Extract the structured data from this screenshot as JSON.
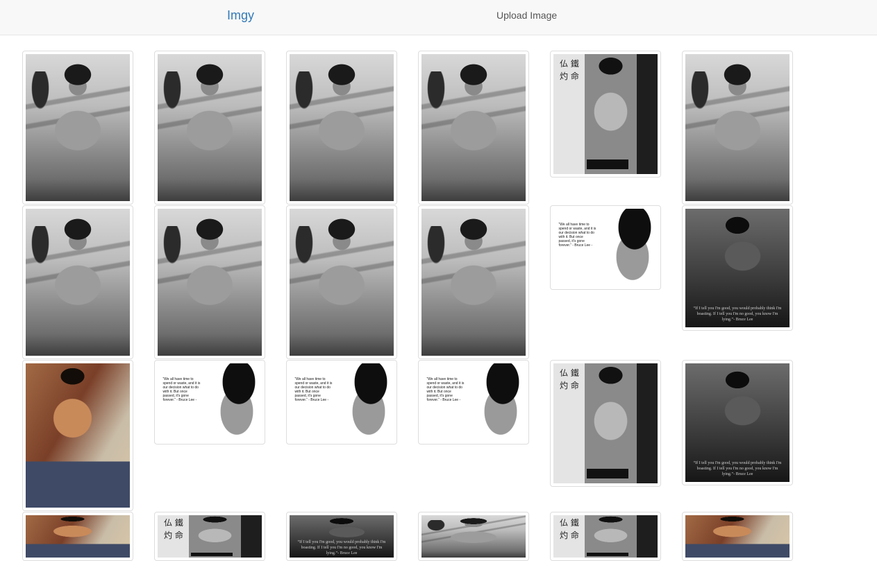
{
  "navbar": {
    "brand": "Imgy",
    "upload_link": "Upload Image"
  },
  "gallery": {
    "photos": [
      {
        "name": "photo-shirtless-porch"
      },
      {
        "name": "photo-shirtless-porch"
      },
      {
        "name": "photo-shirtless-porch"
      },
      {
        "name": "photo-shirtless-porch"
      },
      {
        "name": "photo-sunglasses-calligraphy"
      },
      {
        "name": "photo-shirtless-porch"
      },
      {
        "name": "photo-shirtless-porch"
      },
      {
        "name": "photo-shirtless-porch"
      },
      {
        "name": "photo-shirtless-porch"
      },
      {
        "name": "photo-shirtless-porch"
      },
      {
        "name": "photo-quote-closeup"
      },
      {
        "name": "photo-quote-sitting"
      },
      {
        "name": "photo-color-jeans"
      },
      {
        "name": "photo-quote-closeup"
      },
      {
        "name": "photo-quote-closeup"
      },
      {
        "name": "photo-quote-closeup"
      },
      {
        "name": "photo-sunglasses-calligraphy"
      },
      {
        "name": "photo-quote-sitting"
      },
      {
        "name": "photo-color-jeans"
      },
      {
        "name": "photo-sunglasses-calligraphy"
      },
      {
        "name": "photo-quote-sitting"
      },
      {
        "name": "photo-shirtless-porch"
      },
      {
        "name": "photo-sunglasses-calligraphy"
      },
      {
        "name": "photo-color-jeans"
      }
    ]
  }
}
